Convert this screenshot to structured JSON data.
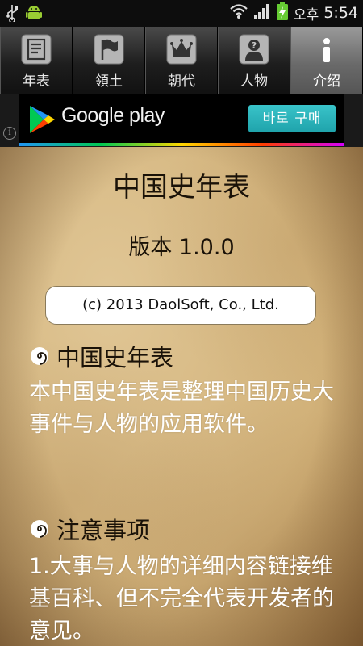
{
  "status_bar": {
    "ampm": "오후",
    "time": "5:54"
  },
  "tabs": [
    {
      "label": "年表",
      "icon": "document-icon",
      "active": false
    },
    {
      "label": "領土",
      "icon": "flag-icon",
      "active": false
    },
    {
      "label": "朝代",
      "icon": "crown-icon",
      "active": false
    },
    {
      "label": "人物",
      "icon": "person-question-icon",
      "active": false
    },
    {
      "label": "介绍",
      "icon": "info-icon",
      "active": true
    }
  ],
  "ad": {
    "brand": "Google play",
    "buy_label": "바로 구매",
    "info": "i"
  },
  "main": {
    "title": "中国史年表",
    "version": "版本 1.0.0",
    "copyright": "(c) 2013 DaolSoft, Co., Ltd.",
    "sections": [
      {
        "heading": "中国史年表",
        "body": "本中国史年表是整理中国历史大事件与人物的应用软件。"
      },
      {
        "heading": "注意事项",
        "body": "1.大事与人物的详细内容链接维基百科、但不完全代表开发者的意见。"
      }
    ]
  },
  "colors": {
    "active_tab": "#7a7a7a",
    "buy_button": "#2bb3ba",
    "parchment": "#d2b27a"
  }
}
